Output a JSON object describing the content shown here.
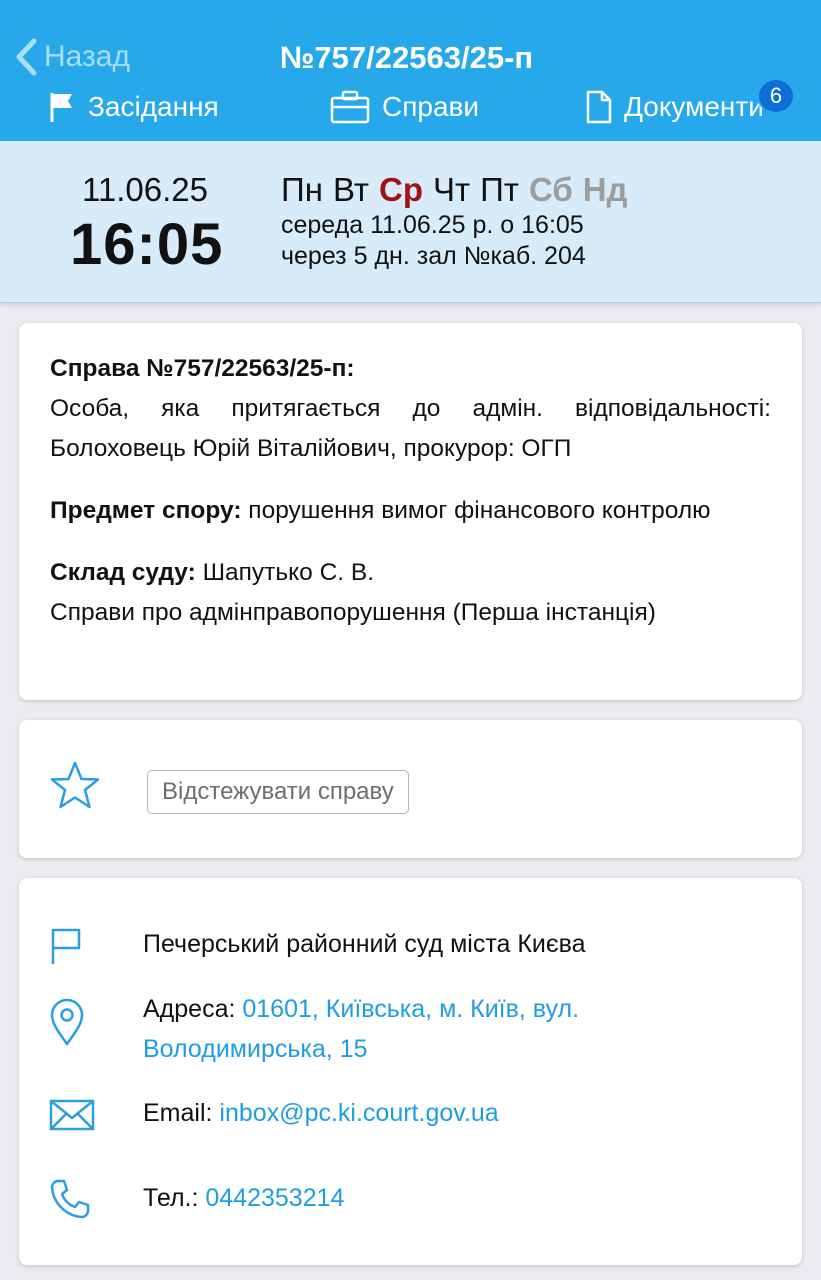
{
  "header": {
    "back_label": "Назад",
    "title": "№757/22563/25-п",
    "tabs": [
      {
        "label": "Засідання",
        "icon": "flag-icon"
      },
      {
        "label": "Справи",
        "icon": "briefcase-icon"
      },
      {
        "label": "Документи",
        "icon": "document-icon"
      }
    ],
    "documents_count": "6"
  },
  "schedule": {
    "date": "11.06.25",
    "time": "16:05",
    "weekdays": [
      "Пн",
      "Вт",
      "Ср",
      "Чт",
      "Пт",
      "Сб",
      "Нд"
    ],
    "active_weekday": "Ср",
    "line1": "середа 11.06.25 р. о 16:05",
    "line2": "через 5 дн. зал №каб. 204"
  },
  "case": {
    "heading": "Справа №757/22563/25-п:",
    "parties": "Особа, яка притягається до адмін. відповідальності: Болоховець Юрій Віталійович, прокурор: ОГП",
    "subject_label": "Предмет спору:",
    "subject_value": "порушення вимог фінансового контролю",
    "court_label": "Склад суду:",
    "court_value": "Шапутько С. В.",
    "category": "Справи про адмінправопорушення (Перша інстанція)"
  },
  "tracking": {
    "button_label": "Відстежувати справу"
  },
  "court": {
    "name": "Печерський районний суд міста Києва",
    "address_label": "Адреса:",
    "address_value": "01601, Київська, м. Київ, вул. Володимирська, 15",
    "email_label": "Email:",
    "email_value": "inbox@pc.ki.court.gov.ua",
    "phone_label": "Тел.:",
    "phone_value": "0442353214"
  },
  "colors": {
    "header": "#27a8ea",
    "dateband": "#d7ecf8",
    "accent": "#1e9ee0",
    "active_day": "#a21313",
    "weekend": "#9d9d9d",
    "badge": "#0d6fd6"
  }
}
